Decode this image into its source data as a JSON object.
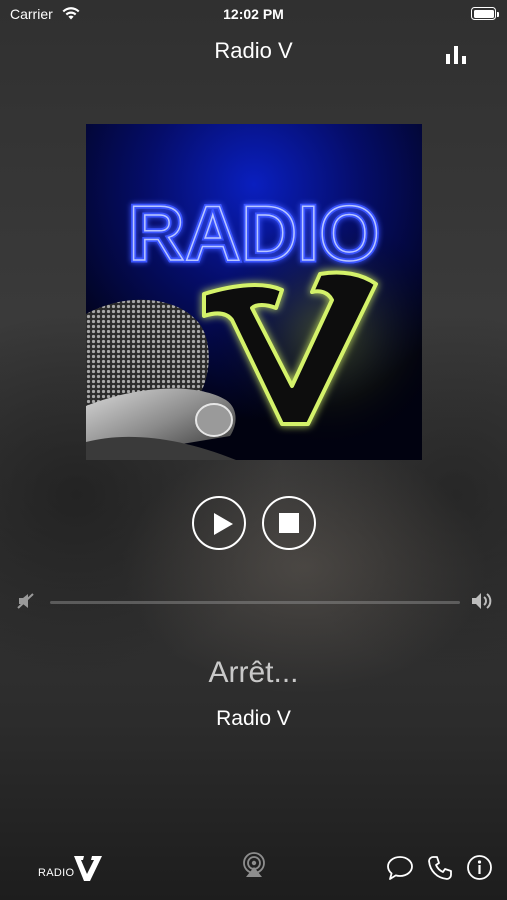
{
  "status_bar": {
    "carrier": "Carrier",
    "time": "12:02 PM"
  },
  "nav": {
    "title": "Radio V",
    "right_icon": "equalizer-bars-icon"
  },
  "artwork": {
    "logo_text": "RADIO",
    "logo_letter": "V",
    "colors": {
      "neon_blue": "#2f4bff",
      "neon_green": "#d4f26a"
    }
  },
  "player": {
    "play_icon": "play-icon",
    "stop_icon": "stop-icon",
    "volume_min_icon": "speaker-muted-icon",
    "volume_max_icon": "speaker-loud-icon",
    "status": "Arrêt...",
    "station": "Radio V"
  },
  "tab_bar": {
    "logo_word": "RADIO",
    "logo_letter": "V",
    "icons": [
      "airplay-icon",
      "chat-bubble-icon",
      "phone-icon",
      "info-icon"
    ]
  }
}
